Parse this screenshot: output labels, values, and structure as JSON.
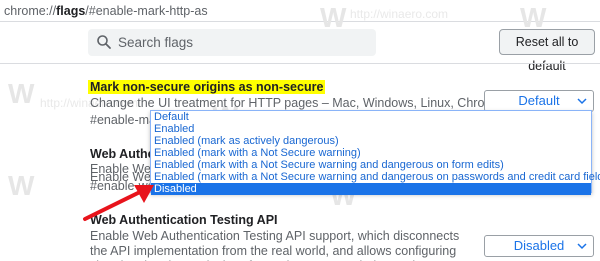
{
  "address": {
    "scheme": "chrome://",
    "host": "flags",
    "path": "/#enable-mark-http-as"
  },
  "search": {
    "placeholder": "Search flags"
  },
  "toolbar": {
    "reset_label": "Reset all to default"
  },
  "flags": [
    {
      "title": "Mark non-secure origins as non-secure",
      "description": "Change the UI treatment for HTTP pages – Mac, Windows, Linux, Chrome OS, Android",
      "link": "#enable-mark-http-as",
      "select_value": "Default"
    },
    {
      "title": "Web Authentication",
      "description": "Enable Web Au",
      "description2": "Enable Web Ac",
      "link": "#enable-web-a"
    },
    {
      "title": "Web Authentication Testing API",
      "description": "Enable Web Authentication Testing API support, which disconnects the API implementation from the real world, and allows configuring virtual authenticator devices for testing – Mac, Windows, Linux, Chrome OS",
      "select_value": "Disabled"
    }
  ],
  "dropdown": {
    "options": [
      "Default",
      "Enabled",
      "Enabled (mark as actively dangerous)",
      "Enabled (mark with a Not Secure warning)",
      "Enabled (mark with a Not Secure warning and dangerous on form edits)",
      "Enabled (mark with a Not Secure warning and dangerous on passwords and credit card fields)",
      "Disabled"
    ],
    "selected_index": 6
  },
  "watermark": {
    "logo_letter": "W",
    "text": "http://winaero.com"
  },
  "colors": {
    "accent": "#1a73e8",
    "highlight": "#ffff00",
    "arrow": "#e8141c"
  }
}
